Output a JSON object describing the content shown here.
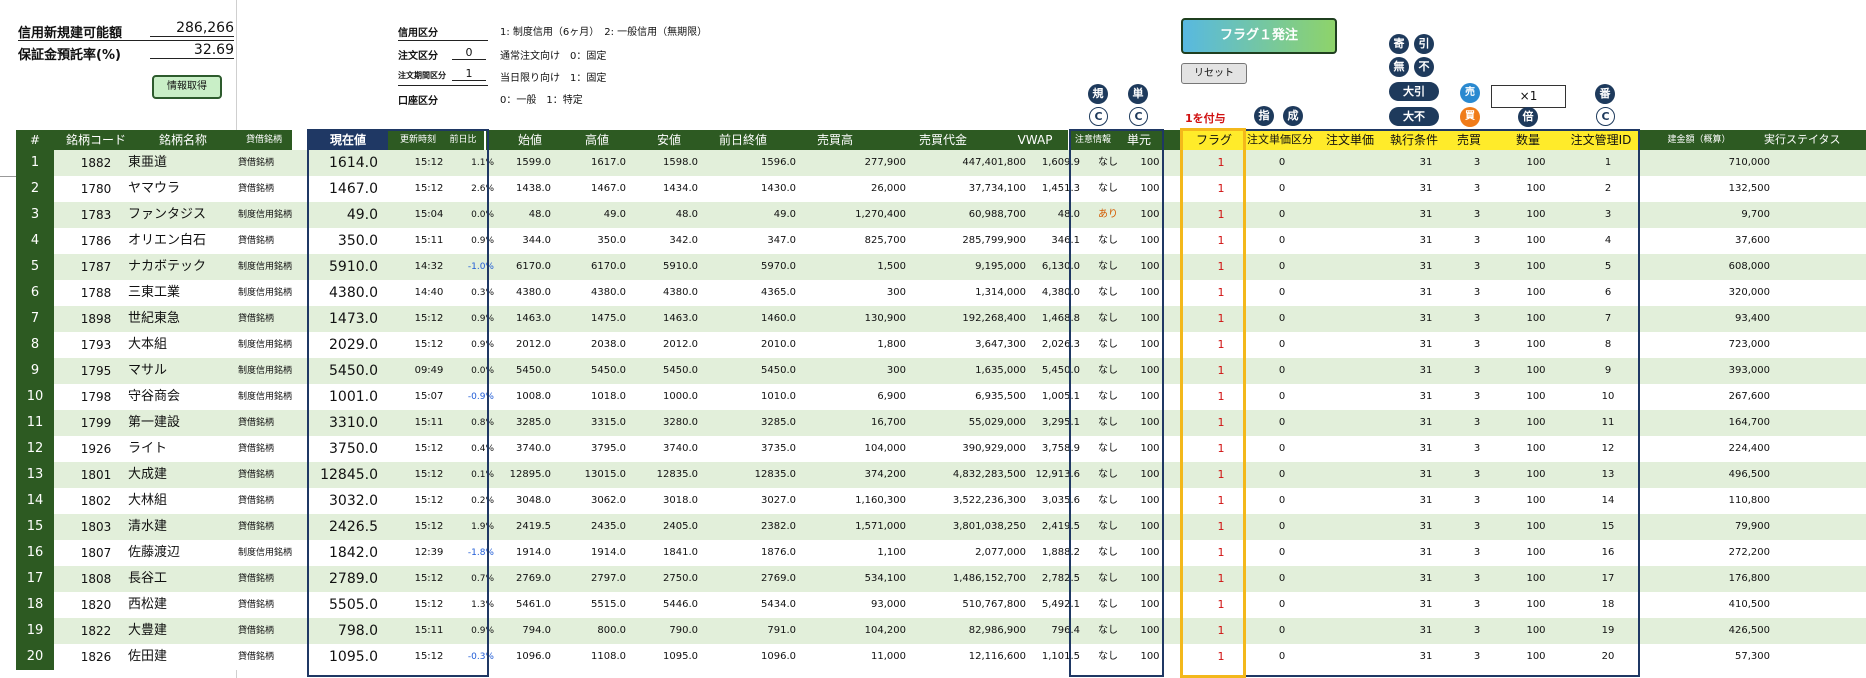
{
  "summary": {
    "credit_available_label": "信用新規建可能額",
    "credit_available_value": "286,266",
    "margin_rate_label": "保証金預託率(%)",
    "margin_rate_value": "32.69",
    "info_button": "情報取得"
  },
  "settings": [
    {
      "label": "信用区分",
      "value": "",
      "desc": "1: 制度信用（6ヶ月）　2: 一般信用（無期限）"
    },
    {
      "label": "注文区分",
      "value": "0",
      "desc": "通常注文向け　0：固定"
    },
    {
      "label": "注文期間区分",
      "value": "1",
      "desc": "当日限り向け　1：固定"
    },
    {
      "label": "口座区分",
      "value": "",
      "desc": "0：一般　1：特定"
    }
  ],
  "buttons": {
    "flag_order": "フラグ１発注",
    "reset": "リセット"
  },
  "badges": {
    "yori": "寄",
    "hiki": "引",
    "mu": "無",
    "fu": "不",
    "oobiki": "大引",
    "oofu": "大不",
    "uri": "売",
    "kai": "買",
    "kaku": "規",
    "tan": "単",
    "sashi": "指",
    "nari": "成",
    "bai": "倍",
    "ban": "番",
    "c": "C",
    "multiplier": "×1",
    "flag_hint": "1を付与"
  },
  "colors": {
    "header_green": "#2d5a22",
    "header_navy": "#1f3864",
    "header_yellow": "#ffeb2a",
    "row_light": "#e2efda",
    "flag_red": "#d01010",
    "negative_blue": "#1f5bd6"
  },
  "headers": {
    "num": "#",
    "code": "銘柄コード",
    "name": "銘柄名称",
    "type": "貸借銘柄",
    "price": "現在値",
    "time": "更新時刻",
    "chg": "前日比",
    "open": "始値",
    "high": "高値",
    "low": "安値",
    "prev": "前日終値",
    "volume": "売買高",
    "turnover": "売買代金",
    "vwap": "VWAP",
    "alert": "注意情報",
    "unit": "単元",
    "flag": "フラグ",
    "order_type": "注文単価区分",
    "order_price": "注文単価",
    "exec_cond": "執行条件",
    "side": "売買",
    "qty": "数量",
    "order_id": "注文管理ID",
    "amount": "建金額（概算）",
    "status": "実行ステイタス"
  },
  "rows": [
    {
      "num": "1",
      "code": "1882",
      "name": "東亜道",
      "type": "貸借銘柄",
      "price": "1614.0",
      "time": "15:12",
      "chg": "1.1%",
      "open": "1599.0",
      "high": "1617.0",
      "low": "1598.0",
      "prev": "1596.0",
      "volume": "277,900",
      "turnover": "447,401,800",
      "vwap": "1,609.9",
      "alert": "なし",
      "unit": "100",
      "flag": "1",
      "order_type": "0",
      "exec": "31",
      "side": "3",
      "qty": "100",
      "oid": "1",
      "amount": "710,000"
    },
    {
      "num": "2",
      "code": "1780",
      "name": "ヤマウラ",
      "type": "貸借銘柄",
      "price": "1467.0",
      "time": "15:12",
      "chg": "2.6%",
      "open": "1438.0",
      "high": "1467.0",
      "low": "1434.0",
      "prev": "1430.0",
      "volume": "26,000",
      "turnover": "37,734,100",
      "vwap": "1,451.3",
      "alert": "なし",
      "unit": "100",
      "flag": "1",
      "order_type": "0",
      "exec": "31",
      "side": "3",
      "qty": "100",
      "oid": "2",
      "amount": "132,500"
    },
    {
      "num": "3",
      "code": "1783",
      "name": "ファンタジス",
      "type": "制度信用銘柄",
      "price": "49.0",
      "time": "15:04",
      "chg": "0.0%",
      "open": "48.0",
      "high": "49.0",
      "low": "48.0",
      "prev": "49.0",
      "volume": "1,270,400",
      "turnover": "60,988,700",
      "vwap": "48.0",
      "alert": "あり",
      "unit": "100",
      "flag": "1",
      "order_type": "0",
      "exec": "31",
      "side": "3",
      "qty": "100",
      "oid": "3",
      "amount": "9,700"
    },
    {
      "num": "4",
      "code": "1786",
      "name": "オリエン白石",
      "type": "貸借銘柄",
      "price": "350.0",
      "time": "15:11",
      "chg": "0.9%",
      "open": "344.0",
      "high": "350.0",
      "low": "342.0",
      "prev": "347.0",
      "volume": "825,700",
      "turnover": "285,799,900",
      "vwap": "346.1",
      "alert": "なし",
      "unit": "100",
      "flag": "1",
      "order_type": "0",
      "exec": "31",
      "side": "3",
      "qty": "100",
      "oid": "4",
      "amount": "37,600"
    },
    {
      "num": "5",
      "code": "1787",
      "name": "ナカボテック",
      "type": "制度信用銘柄",
      "price": "5910.0",
      "time": "14:32",
      "chg": "-1.0%",
      "open": "6170.0",
      "high": "6170.0",
      "low": "5910.0",
      "prev": "5970.0",
      "volume": "1,500",
      "turnover": "9,195,000",
      "vwap": "6,130.0",
      "alert": "なし",
      "unit": "100",
      "flag": "1",
      "order_type": "0",
      "exec": "31",
      "side": "3",
      "qty": "100",
      "oid": "5",
      "amount": "608,000"
    },
    {
      "num": "6",
      "code": "1788",
      "name": "三東工業",
      "type": "制度信用銘柄",
      "price": "4380.0",
      "time": "14:40",
      "chg": "0.3%",
      "open": "4380.0",
      "high": "4380.0",
      "low": "4380.0",
      "prev": "4365.0",
      "volume": "300",
      "turnover": "1,314,000",
      "vwap": "4,380.0",
      "alert": "なし",
      "unit": "100",
      "flag": "1",
      "order_type": "0",
      "exec": "31",
      "side": "3",
      "qty": "100",
      "oid": "6",
      "amount": "320,000"
    },
    {
      "num": "7",
      "code": "1898",
      "name": "世紀東急",
      "type": "貸借銘柄",
      "price": "1473.0",
      "time": "15:12",
      "chg": "0.9%",
      "open": "1463.0",
      "high": "1475.0",
      "low": "1463.0",
      "prev": "1460.0",
      "volume": "130,900",
      "turnover": "192,268,400",
      "vwap": "1,468.8",
      "alert": "なし",
      "unit": "100",
      "flag": "1",
      "order_type": "0",
      "exec": "31",
      "side": "3",
      "qty": "100",
      "oid": "7",
      "amount": "93,400"
    },
    {
      "num": "8",
      "code": "1793",
      "name": "大本組",
      "type": "制度信用銘柄",
      "price": "2029.0",
      "time": "15:12",
      "chg": "0.9%",
      "open": "2012.0",
      "high": "2038.0",
      "low": "2012.0",
      "prev": "2010.0",
      "volume": "1,800",
      "turnover": "3,647,300",
      "vwap": "2,026.3",
      "alert": "なし",
      "unit": "100",
      "flag": "1",
      "order_type": "0",
      "exec": "31",
      "side": "3",
      "qty": "100",
      "oid": "8",
      "amount": "723,000"
    },
    {
      "num": "9",
      "code": "1795",
      "name": "マサル",
      "type": "制度信用銘柄",
      "price": "5450.0",
      "time": "09:49",
      "chg": "0.0%",
      "open": "5450.0",
      "high": "5450.0",
      "low": "5450.0",
      "prev": "5450.0",
      "volume": "300",
      "turnover": "1,635,000",
      "vwap": "5,450.0",
      "alert": "なし",
      "unit": "100",
      "flag": "1",
      "order_type": "0",
      "exec": "31",
      "side": "3",
      "qty": "100",
      "oid": "9",
      "amount": "393,000"
    },
    {
      "num": "10",
      "code": "1798",
      "name": "守谷商会",
      "type": "制度信用銘柄",
      "price": "1001.0",
      "time": "15:07",
      "chg": "-0.9%",
      "open": "1008.0",
      "high": "1018.0",
      "low": "1000.0",
      "prev": "1010.0",
      "volume": "6,900",
      "turnover": "6,935,500",
      "vwap": "1,005.1",
      "alert": "なし",
      "unit": "100",
      "flag": "1",
      "order_type": "0",
      "exec": "31",
      "side": "3",
      "qty": "100",
      "oid": "10",
      "amount": "267,600"
    },
    {
      "num": "11",
      "code": "1799",
      "name": "第一建設",
      "type": "貸借銘柄",
      "price": "3310.0",
      "time": "15:11",
      "chg": "0.8%",
      "open": "3285.0",
      "high": "3315.0",
      "low": "3280.0",
      "prev": "3285.0",
      "volume": "16,700",
      "turnover": "55,029,000",
      "vwap": "3,295.1",
      "alert": "なし",
      "unit": "100",
      "flag": "1",
      "order_type": "0",
      "exec": "31",
      "side": "3",
      "qty": "100",
      "oid": "11",
      "amount": "164,700"
    },
    {
      "num": "12",
      "code": "1926",
      "name": "ライト",
      "type": "貸借銘柄",
      "price": "3750.0",
      "time": "15:12",
      "chg": "0.4%",
      "open": "3740.0",
      "high": "3795.0",
      "low": "3740.0",
      "prev": "3735.0",
      "volume": "104,000",
      "turnover": "390,929,000",
      "vwap": "3,758.9",
      "alert": "なし",
      "unit": "100",
      "flag": "1",
      "order_type": "0",
      "exec": "31",
      "side": "3",
      "qty": "100",
      "oid": "12",
      "amount": "224,400"
    },
    {
      "num": "13",
      "code": "1801",
      "name": "大成建",
      "type": "貸借銘柄",
      "price": "12845.0",
      "time": "15:12",
      "chg": "0.1%",
      "open": "12895.0",
      "high": "13015.0",
      "low": "12835.0",
      "prev": "12835.0",
      "volume": "374,200",
      "turnover": "4,832,283,500",
      "vwap": "12,913.6",
      "alert": "なし",
      "unit": "100",
      "flag": "1",
      "order_type": "0",
      "exec": "31",
      "side": "3",
      "qty": "100",
      "oid": "13",
      "amount": "496,500"
    },
    {
      "num": "14",
      "code": "1802",
      "name": "大林組",
      "type": "貸借銘柄",
      "price": "3032.0",
      "time": "15:12",
      "chg": "0.2%",
      "open": "3048.0",
      "high": "3062.0",
      "low": "3018.0",
      "prev": "3027.0",
      "volume": "1,160,300",
      "turnover": "3,522,236,300",
      "vwap": "3,035.6",
      "alert": "なし",
      "unit": "100",
      "flag": "1",
      "order_type": "0",
      "exec": "31",
      "side": "3",
      "qty": "100",
      "oid": "14",
      "amount": "110,800"
    },
    {
      "num": "15",
      "code": "1803",
      "name": "清水建",
      "type": "貸借銘柄",
      "price": "2426.5",
      "time": "15:12",
      "chg": "1.9%",
      "open": "2419.5",
      "high": "2435.0",
      "low": "2405.0",
      "prev": "2382.0",
      "volume": "1,571,000",
      "turnover": "3,801,038,250",
      "vwap": "2,419.5",
      "alert": "なし",
      "unit": "100",
      "flag": "1",
      "order_type": "0",
      "exec": "31",
      "side": "3",
      "qty": "100",
      "oid": "15",
      "amount": "79,900"
    },
    {
      "num": "16",
      "code": "1807",
      "name": "佐藤渡辺",
      "type": "制度信用銘柄",
      "price": "1842.0",
      "time": "12:39",
      "chg": "-1.8%",
      "open": "1914.0",
      "high": "1914.0",
      "low": "1841.0",
      "prev": "1876.0",
      "volume": "1,100",
      "turnover": "2,077,000",
      "vwap": "1,888.2",
      "alert": "なし",
      "unit": "100",
      "flag": "1",
      "order_type": "0",
      "exec": "31",
      "side": "3",
      "qty": "100",
      "oid": "16",
      "amount": "272,200"
    },
    {
      "num": "17",
      "code": "1808",
      "name": "長谷工",
      "type": "貸借銘柄",
      "price": "2789.0",
      "time": "15:12",
      "chg": "0.7%",
      "open": "2769.0",
      "high": "2797.0",
      "low": "2750.0",
      "prev": "2769.0",
      "volume": "534,100",
      "turnover": "1,486,152,700",
      "vwap": "2,782.5",
      "alert": "なし",
      "unit": "100",
      "flag": "1",
      "order_type": "0",
      "exec": "31",
      "side": "3",
      "qty": "100",
      "oid": "17",
      "amount": "176,800"
    },
    {
      "num": "18",
      "code": "1820",
      "name": "西松建",
      "type": "貸借銘柄",
      "price": "5505.0",
      "time": "15:12",
      "chg": "1.3%",
      "open": "5461.0",
      "high": "5515.0",
      "low": "5446.0",
      "prev": "5434.0",
      "volume": "93,000",
      "turnover": "510,767,800",
      "vwap": "5,492.1",
      "alert": "なし",
      "unit": "100",
      "flag": "1",
      "order_type": "0",
      "exec": "31",
      "side": "3",
      "qty": "100",
      "oid": "18",
      "amount": "410,500"
    },
    {
      "num": "19",
      "code": "1822",
      "name": "大豊建",
      "type": "貸借銘柄",
      "price": "798.0",
      "time": "15:11",
      "chg": "0.9%",
      "open": "794.0",
      "high": "800.0",
      "low": "790.0",
      "prev": "791.0",
      "volume": "104,200",
      "turnover": "82,986,900",
      "vwap": "796.4",
      "alert": "なし",
      "unit": "100",
      "flag": "1",
      "order_type": "0",
      "exec": "31",
      "side": "3",
      "qty": "100",
      "oid": "19",
      "amount": "426,500"
    },
    {
      "num": "20",
      "code": "1826",
      "name": "佐田建",
      "type": "貸借銘柄",
      "price": "1095.0",
      "time": "15:12",
      "chg": "-0.3%",
      "open": "1096.0",
      "high": "1108.0",
      "low": "1095.0",
      "prev": "1096.0",
      "volume": "11,000",
      "turnover": "12,116,600",
      "vwap": "1,101.5",
      "alert": "なし",
      "unit": "100",
      "flag": "1",
      "order_type": "0",
      "exec": "31",
      "side": "3",
      "qty": "100",
      "oid": "20",
      "amount": "57,300"
    }
  ]
}
